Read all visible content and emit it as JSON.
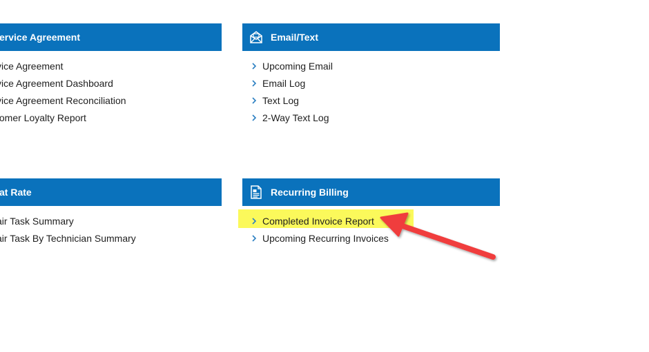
{
  "colors": {
    "header_bg": "#0a72bc",
    "header_text": "#ffffff",
    "link_text": "#1e1e1e",
    "chevron": "#2b7fc2",
    "highlight": "#fbf95b",
    "annotation_arrow": "#f03c3c"
  },
  "panels": {
    "service_agreement": {
      "title": "ervice Agreement",
      "items": [
        "vice Agreement",
        "vice Agreement Dashboard",
        "vice Agreement Reconciliation",
        "tomer Loyalty Report"
      ]
    },
    "email_text": {
      "title": "Email/Text",
      "icon": "envelope-icon",
      "items": [
        "Upcoming Email",
        "Email Log",
        "Text Log",
        "2-Way Text Log"
      ]
    },
    "flat_rate": {
      "title": "at Rate",
      "items": [
        "air Task Summary",
        "air Task By Technician Summary"
      ]
    },
    "recurring_billing": {
      "title": "Recurring Billing",
      "icon": "invoice-document-icon",
      "items": [
        "Completed Invoice Report",
        "Upcoming Recurring Invoices"
      ]
    }
  },
  "annotation": {
    "type": "arrow",
    "target": "Completed Invoice Report"
  }
}
